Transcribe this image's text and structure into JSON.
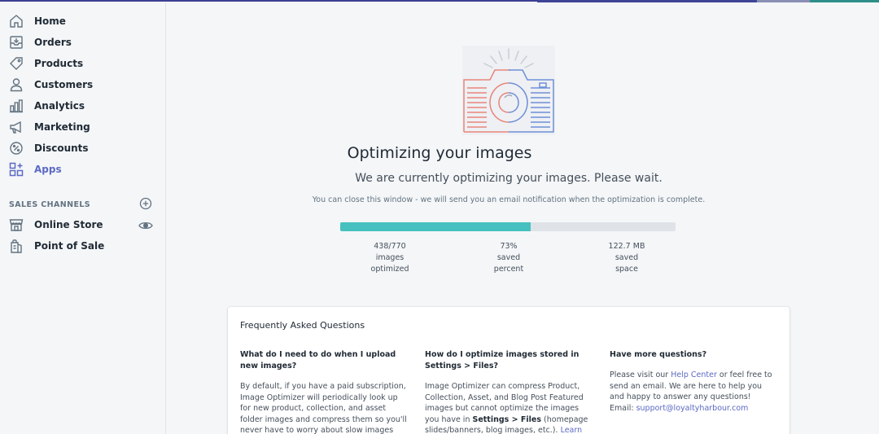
{
  "sidebar": {
    "items": [
      {
        "label": "Home",
        "icon": "home-icon"
      },
      {
        "label": "Orders",
        "icon": "orders-icon"
      },
      {
        "label": "Products",
        "icon": "tag-icon"
      },
      {
        "label": "Customers",
        "icon": "person-icon"
      },
      {
        "label": "Analytics",
        "icon": "bar-chart-icon"
      },
      {
        "label": "Marketing",
        "icon": "megaphone-icon"
      },
      {
        "label": "Discounts",
        "icon": "discount-icon"
      },
      {
        "label": "Apps",
        "icon": "apps-icon"
      }
    ],
    "sales_channels_title": "SALES CHANNELS",
    "channels": [
      {
        "label": "Online Store",
        "icon": "store-icon"
      },
      {
        "label": "Point of Sale",
        "icon": "pos-bag-icon"
      }
    ]
  },
  "main": {
    "title": "Optimizing your images",
    "subtitle": "We are currently optimizing your images. Please wait.",
    "note": "You can close this window - we will send you an email notification when the optimization is complete.",
    "progress": 0.5687,
    "stats": [
      {
        "line1": "438/770",
        "line2": "images",
        "line3": "optimized"
      },
      {
        "line1": "73%",
        "line2": "saved",
        "line3": "percent"
      },
      {
        "line1": "122.7 MB",
        "line2": "saved",
        "line3": "space"
      }
    ]
  },
  "faq": {
    "title": "Frequently Asked Questions",
    "q1": {
      "question": "What do I need to do when I upload new images?",
      "answer": "By default, if you have a paid subscription, Image Optimizer will periodically look up for new product, collection, and asset folder images and compress them so you'll never have to worry about slow images and can"
    },
    "q2": {
      "question": "How do I optimize images stored in Settings > Files?",
      "answer_a": "Image Optimizer can compress Product, Collection, Asset, and Blog Post Featured images but cannot optimize the images you have in ",
      "answer_bold": "Settings > Files",
      "answer_b": " (homepage slides/banners, blog images, etc.). ",
      "answer_link": "Learn"
    },
    "q3": {
      "question": "Have more questions?",
      "answer_a": "Please visit our ",
      "help_link": "Help Center",
      "answer_b": " or feel free to send an email. We are here to help you and happy to answer any questions!",
      "email_label": "Email: ",
      "email": "support@loyaltyharbour.com"
    }
  },
  "colors": {
    "accent": "#5c6ac4",
    "progress_fill": "#47c1bf",
    "progress_track": "#dfe3e8"
  }
}
